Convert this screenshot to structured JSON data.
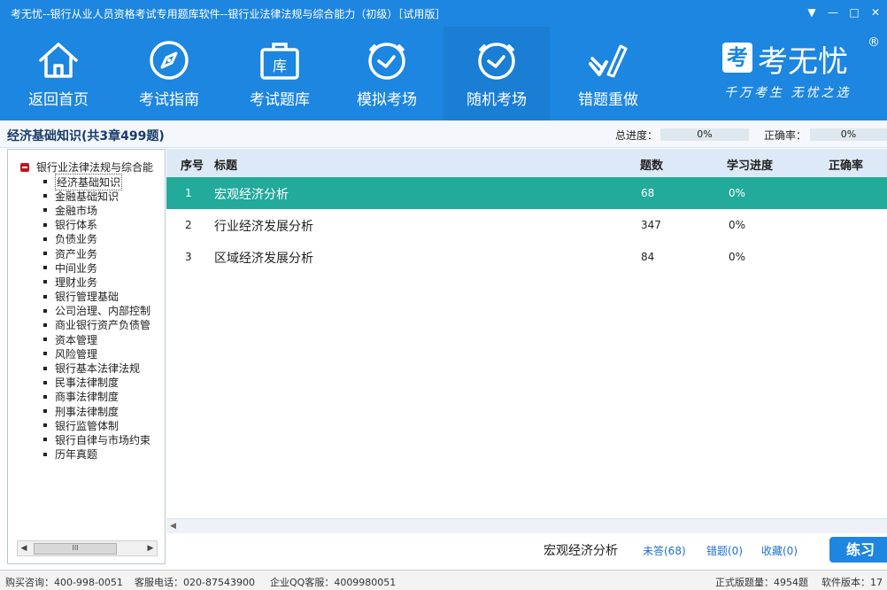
{
  "window": {
    "title": "考无忧--银行从业人员资格考试专用题库软件--银行业法律法规与综合能力（初级）［试用版］",
    "controls": [
      "▼",
      "—",
      "□",
      "✕"
    ]
  },
  "toolbar": {
    "items": [
      {
        "label": "返回首页",
        "icon": "home-icon"
      },
      {
        "label": "考试指南",
        "icon": "compass-icon"
      },
      {
        "label": "考试题库",
        "icon": "briefcase-icon",
        "icon_text": "库"
      },
      {
        "label": "模拟考场",
        "icon": "clock-icon"
      },
      {
        "label": "随机考场",
        "icon": "clock-icon"
      },
      {
        "label": "错题重做",
        "icon": "check-pen-icon"
      }
    ],
    "active_index": 4
  },
  "brand": {
    "logo_char": "考",
    "name": "考无忧",
    "registered": "®",
    "slogan": "千万考生  无忧之选"
  },
  "subheader": {
    "course": "经济基础知识(共3章499题)",
    "total_progress_label": "总进度：",
    "total_progress_value": "0%",
    "accuracy_label": "正确率：",
    "accuracy_value": "0%"
  },
  "sidebar": {
    "root": "银行业法律法规与综合能",
    "items": [
      "经济基础知识",
      "金融基础知识",
      "金融市场",
      "银行体系",
      "负债业务",
      "资产业务",
      "中间业务",
      "理财业务",
      "银行管理基础",
      "公司治理、内部控制",
      "商业银行资产负债管",
      "资本管理",
      "风险管理",
      "银行基本法律法规",
      "民事法律制度",
      "商事法律制度",
      "刑事法律制度",
      "银行监管体制",
      "银行自律与市场约束",
      "历年真题"
    ],
    "selected_index": 0,
    "scroll_thumb": "III"
  },
  "table": {
    "headers": {
      "index": "序号",
      "title": "标题",
      "count": "题数",
      "progress": "学习进度",
      "accuracy": "正确率"
    },
    "rows": [
      {
        "index": "1",
        "title": "宏观经济分析",
        "count": "68",
        "progress": "0%",
        "accuracy": ""
      },
      {
        "index": "2",
        "title": "行业经济发展分析",
        "count": "347",
        "progress": "0%",
        "accuracy": ""
      },
      {
        "index": "3",
        "title": "区域经济发展分析",
        "count": "84",
        "progress": "0%",
        "accuracy": ""
      }
    ],
    "selected_index": 0
  },
  "bottombar": {
    "selected_title": "宏观经济分析",
    "unanswered": "未答(68)",
    "wrong": "错题(0)",
    "favorites": "收藏(0)",
    "practice": "练习"
  },
  "statusbar": {
    "purchase": "购买咨询：400-998-0051",
    "service_phone": "客服电话：020-87543900",
    "qq_service": "企业QQ客服：4009980051",
    "question_count": "正式版题量：4954题",
    "version": "软件版本：17"
  },
  "colors": {
    "primary": "#1d86e0",
    "selected_row": "#22aa9b",
    "header_bg": "#dde9f6",
    "root_icon": "#c0161e"
  }
}
